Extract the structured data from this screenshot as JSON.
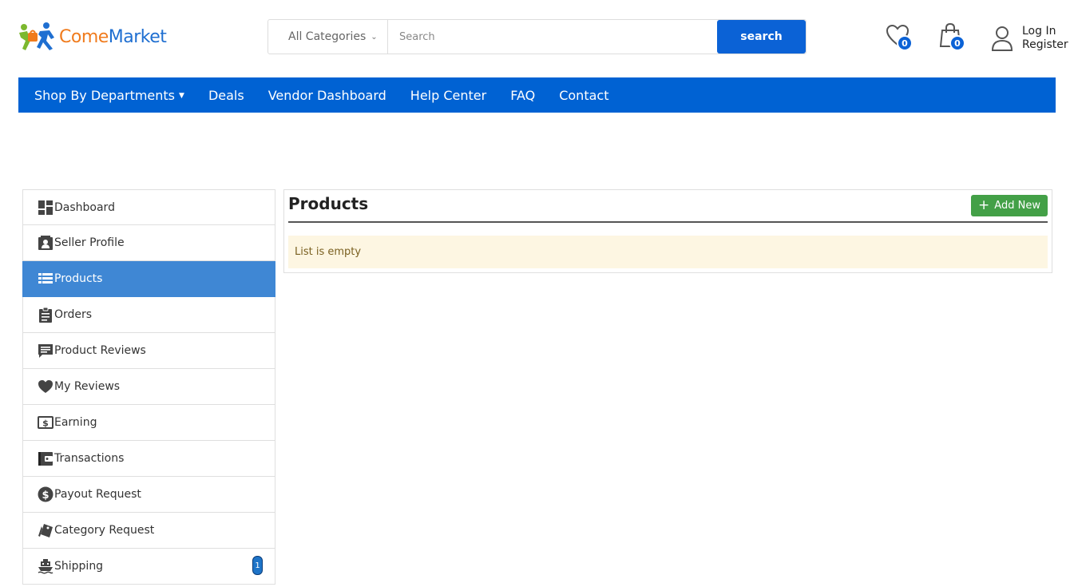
{
  "brand": {
    "part1": "Come",
    "part2": "Market"
  },
  "search": {
    "category_label": "All Categories",
    "placeholder": "Search",
    "button_label": "search"
  },
  "header": {
    "wishlist_count": "0",
    "cart_count": "0",
    "login_label": "Log In",
    "register_label": "Register"
  },
  "nav": {
    "items": [
      {
        "label": "Shop By Departments"
      },
      {
        "label": "Deals"
      },
      {
        "label": "Vendor Dashboard"
      },
      {
        "label": "Help Center"
      },
      {
        "label": "FAQ"
      },
      {
        "label": "Contact"
      }
    ]
  },
  "sidebar": {
    "items": [
      {
        "label": "Dashboard",
        "icon": "dashboard-icon"
      },
      {
        "label": "Seller Profile",
        "icon": "contact-card-icon"
      },
      {
        "label": "Products",
        "icon": "list-icon",
        "active": true
      },
      {
        "label": "Orders",
        "icon": "clipboard-icon"
      },
      {
        "label": "Product Reviews",
        "icon": "comment-icon"
      },
      {
        "label": "My Reviews",
        "icon": "heart-icon"
      },
      {
        "label": "Earning",
        "icon": "money-bill-icon"
      },
      {
        "label": "Transactions",
        "icon": "wallet-icon"
      },
      {
        "label": "Payout Request",
        "icon": "dollar-circle-icon"
      },
      {
        "label": "Category Request",
        "icon": "tags-icon"
      },
      {
        "label": "Shipping",
        "icon": "ship-icon",
        "badge": "1"
      }
    ]
  },
  "main": {
    "title": "Products",
    "add_button_label": "Add New",
    "empty_message": "List is empty"
  },
  "colors": {
    "primary_blue": "#0062d3",
    "active_sidebar": "#3f87d4",
    "add_green": "#43a047",
    "empty_bg": "#fdf6e2",
    "brand_orange": "#f07b1d"
  }
}
